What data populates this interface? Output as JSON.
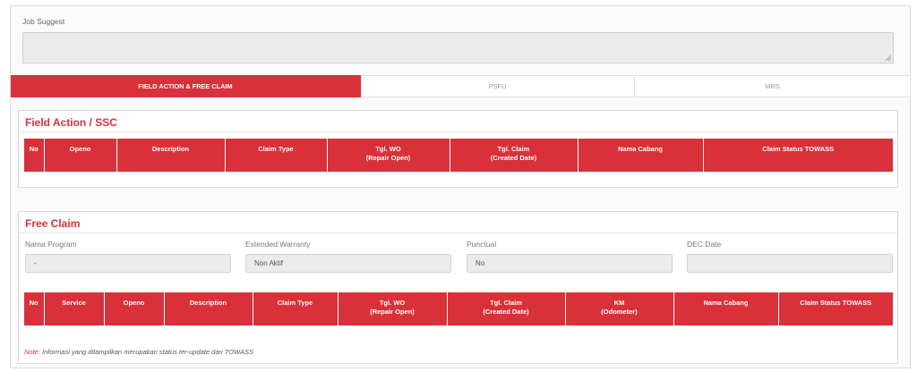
{
  "job_suggest": {
    "label": "Job Suggest",
    "value": ""
  },
  "tabs": [
    {
      "label": "FIELD ACTION & FREE CLAIM",
      "active": true
    },
    {
      "label": "PSFU",
      "active": false
    },
    {
      "label": "MRS",
      "active": false
    }
  ],
  "field_action": {
    "title": "Field Action / SSC",
    "columns": [
      {
        "line1": "No",
        "line2": ""
      },
      {
        "line1": "Openo",
        "line2": ""
      },
      {
        "line1": "Description",
        "line2": ""
      },
      {
        "line1": "Claim Type",
        "line2": ""
      },
      {
        "line1": "Tgl. WO",
        "line2": "(Repair Open)"
      },
      {
        "line1": "Tgl. Claim",
        "line2": "(Created Date)"
      },
      {
        "line1": "Nama Cabang",
        "line2": ""
      },
      {
        "line1": "Claim Status TOWASS",
        "line2": ""
      }
    ]
  },
  "free_claim": {
    "title": "Free Claim",
    "fields": [
      {
        "label": "Nama Program",
        "value": "-"
      },
      {
        "label": "Extended Warranty",
        "value": "Non Aktif"
      },
      {
        "label": "Punctual",
        "value": "No"
      },
      {
        "label": "DEC Date",
        "value": ""
      }
    ],
    "columns": [
      {
        "line1": "No",
        "line2": ""
      },
      {
        "line1": "Service",
        "line2": ""
      },
      {
        "line1": "Openo",
        "line2": ""
      },
      {
        "line1": "Description",
        "line2": ""
      },
      {
        "line1": "Claim Type",
        "line2": ""
      },
      {
        "line1": "Tgl. WO",
        "line2": "(Repair Open)"
      },
      {
        "line1": "Tgl. Claim",
        "line2": "(Created Date)"
      },
      {
        "line1": "KM",
        "line2": "(Odometer)"
      },
      {
        "line1": "Nama Cabang",
        "line2": ""
      },
      {
        "line1": "Claim Status TOWASS",
        "line2": ""
      }
    ],
    "note_key": "Note:",
    "note_text": " Informasi yang ditampilkan merupakan status ter-update dari TOWASS"
  },
  "colors": {
    "accent": "#d9303a",
    "input_bg": "#ebebeb",
    "border": "#d8d8d8"
  }
}
